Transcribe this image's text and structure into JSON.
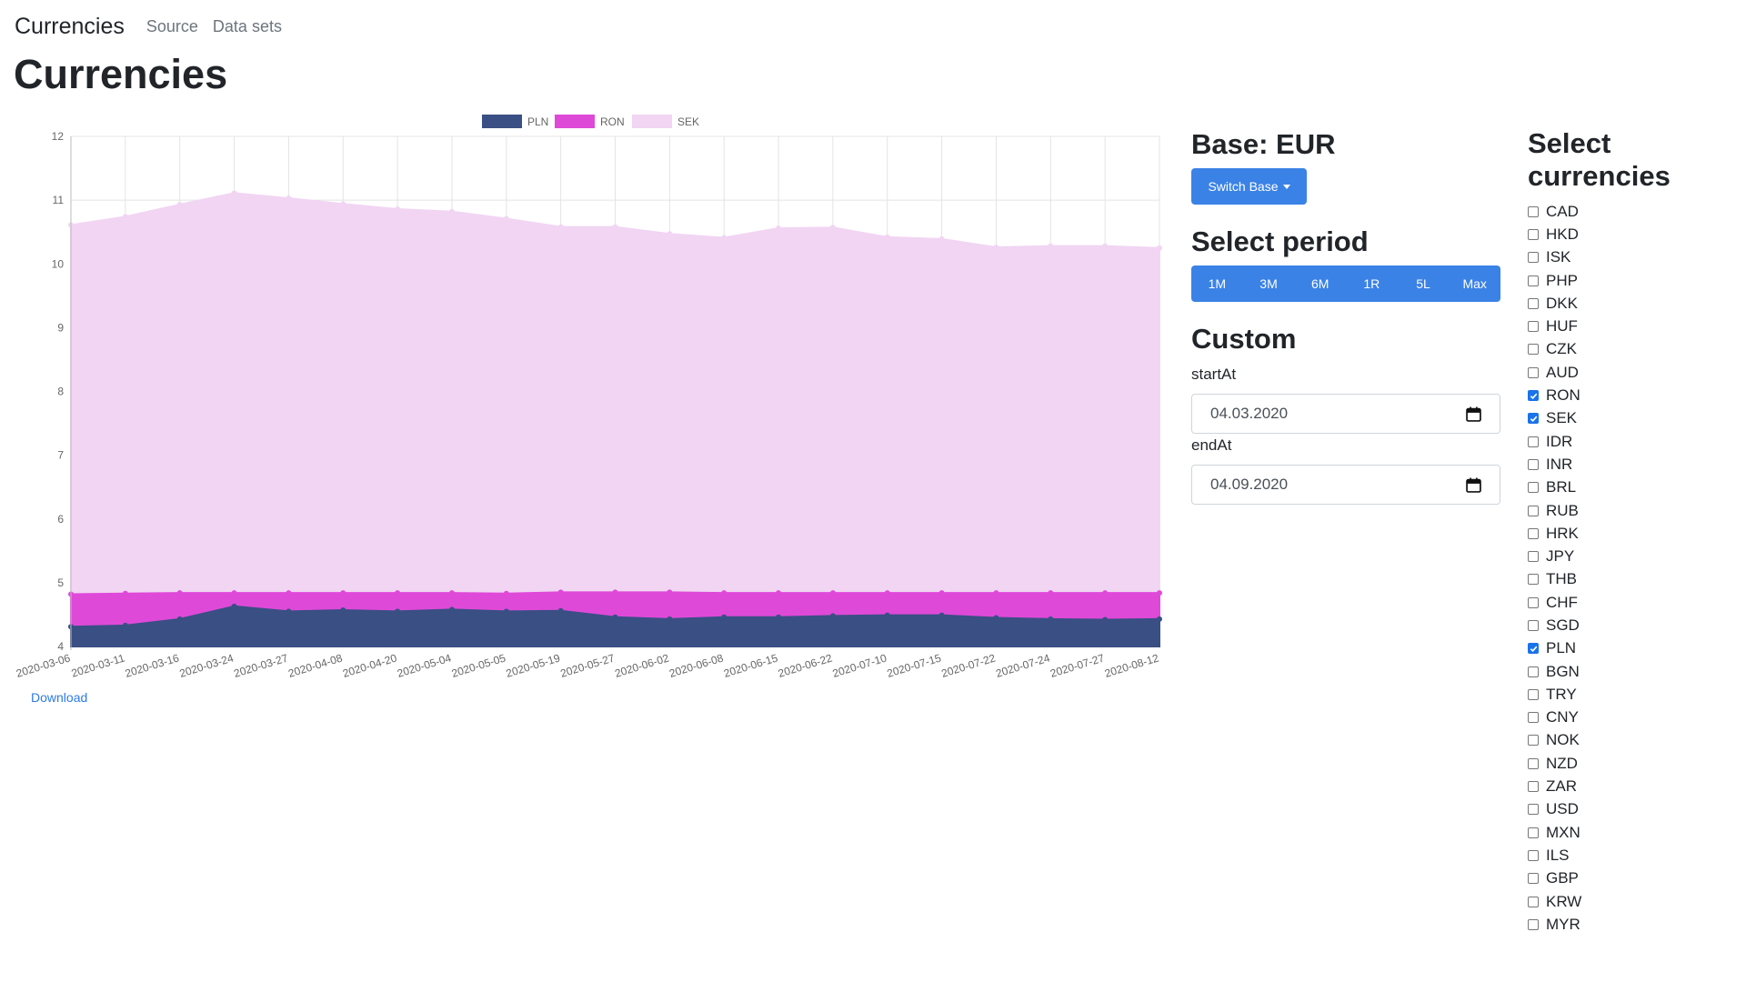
{
  "nav": {
    "brand": "Currencies",
    "links": [
      "Source",
      "Data sets"
    ]
  },
  "page_title": "Currencies",
  "chart_data": {
    "type": "area",
    "stacked": true,
    "x": [
      "2020-03-06",
      "2020-03-11",
      "2020-03-16",
      "2020-03-24",
      "2020-03-27",
      "2020-04-08",
      "2020-04-20",
      "2020-05-04",
      "2020-05-05",
      "2020-05-19",
      "2020-05-27",
      "2020-06-02",
      "2020-06-08",
      "2020-06-15",
      "2020-06-22",
      "2020-07-10",
      "2020-07-15",
      "2020-07-22",
      "2020-07-24",
      "2020-07-27",
      "2020-08-12"
    ],
    "series": [
      {
        "name": "PLN",
        "color": "#3a4f84",
        "values": [
          4.31,
          4.33,
          4.43,
          4.63,
          4.55,
          4.57,
          4.55,
          4.58,
          4.55,
          4.56,
          4.46,
          4.43,
          4.46,
          4.46,
          4.48,
          4.49,
          4.49,
          4.45,
          4.43,
          4.42,
          4.43
        ]
      },
      {
        "name": "RON",
        "color": "#df49d8",
        "values": [
          4.82,
          4.83,
          4.84,
          4.84,
          4.84,
          4.84,
          4.84,
          4.84,
          4.83,
          4.85,
          4.85,
          4.85,
          4.84,
          4.84,
          4.84,
          4.84,
          4.84,
          4.84,
          4.84,
          4.84,
          4.84
        ]
      },
      {
        "name": "SEK",
        "color": "#f1d5f3",
        "values": [
          10.61,
          10.74,
          10.93,
          11.11,
          11.03,
          10.94,
          10.86,
          10.82,
          10.71,
          10.58,
          10.58,
          10.47,
          10.41,
          10.56,
          10.57,
          10.42,
          10.39,
          10.26,
          10.28,
          10.28,
          10.25
        ]
      }
    ],
    "y_ticks": [
      "4",
      "5",
      "6",
      "7",
      "8",
      "9",
      "10",
      "11",
      "12"
    ],
    "ylim": [
      4,
      12
    ],
    "legend": "top",
    "grid": true
  },
  "download_label": "Download",
  "base": {
    "title": "Base: EUR",
    "switch_label": "Switch Base"
  },
  "period": {
    "title": "Select period",
    "options": [
      "1M",
      "3M",
      "6M",
      "1R",
      "5L",
      "Max"
    ]
  },
  "custom": {
    "title": "Custom",
    "start_label": "startAt",
    "start_value": "04.03.2020",
    "end_label": "endAt",
    "end_value": "04.09.2020"
  },
  "currencies": {
    "title": "Select currencies",
    "items": [
      {
        "code": "CAD",
        "checked": false
      },
      {
        "code": "HKD",
        "checked": false
      },
      {
        "code": "ISK",
        "checked": false
      },
      {
        "code": "PHP",
        "checked": false
      },
      {
        "code": "DKK",
        "checked": false
      },
      {
        "code": "HUF",
        "checked": false
      },
      {
        "code": "CZK",
        "checked": false
      },
      {
        "code": "AUD",
        "checked": false
      },
      {
        "code": "RON",
        "checked": true
      },
      {
        "code": "SEK",
        "checked": true
      },
      {
        "code": "IDR",
        "checked": false
      },
      {
        "code": "INR",
        "checked": false
      },
      {
        "code": "BRL",
        "checked": false
      },
      {
        "code": "RUB",
        "checked": false
      },
      {
        "code": "HRK",
        "checked": false
      },
      {
        "code": "JPY",
        "checked": false
      },
      {
        "code": "THB",
        "checked": false
      },
      {
        "code": "CHF",
        "checked": false
      },
      {
        "code": "SGD",
        "checked": false
      },
      {
        "code": "PLN",
        "checked": true
      },
      {
        "code": "BGN",
        "checked": false
      },
      {
        "code": "TRY",
        "checked": false
      },
      {
        "code": "CNY",
        "checked": false
      },
      {
        "code": "NOK",
        "checked": false
      },
      {
        "code": "NZD",
        "checked": false
      },
      {
        "code": "ZAR",
        "checked": false
      },
      {
        "code": "USD",
        "checked": false
      },
      {
        "code": "MXN",
        "checked": false
      },
      {
        "code": "ILS",
        "checked": false
      },
      {
        "code": "GBP",
        "checked": false
      },
      {
        "code": "KRW",
        "checked": false
      },
      {
        "code": "MYR",
        "checked": false
      }
    ]
  }
}
